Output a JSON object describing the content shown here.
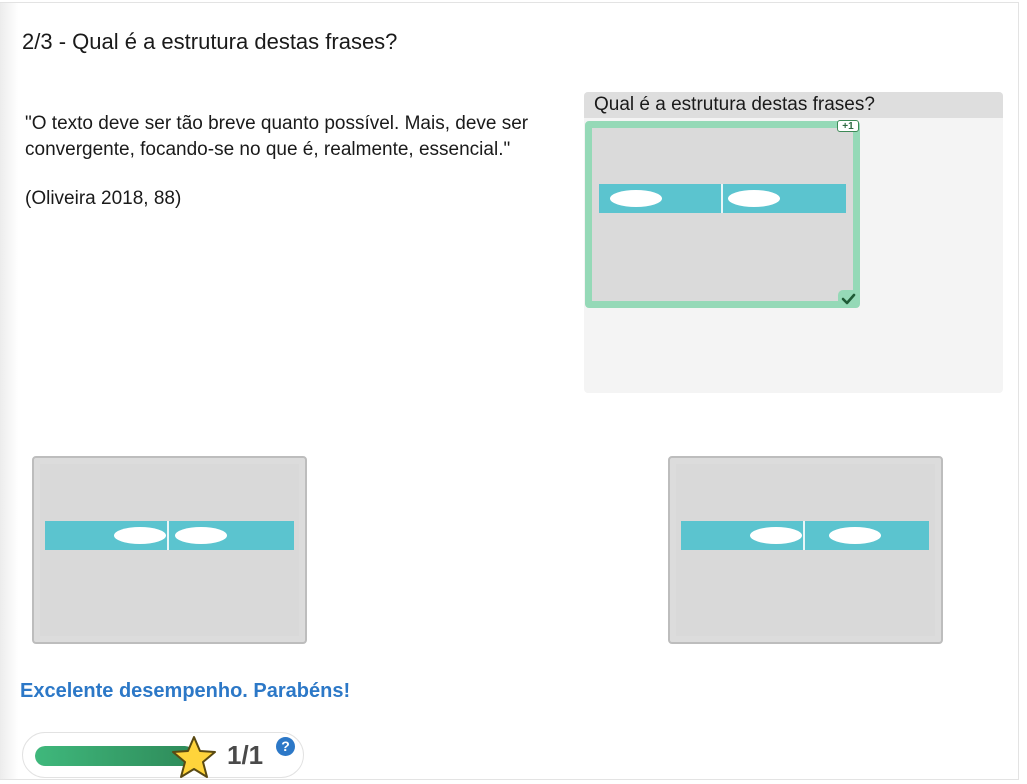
{
  "question": {
    "title": "2/3 - Qual é a estrutura destas frases?",
    "quote": "\"O texto deve ser tão breve quanto possível. Mais, deve ser convergente, focando-se no que é, realmente, essencial.\"",
    "citation": "(Oliveira 2018, 88)"
  },
  "drop_zone": {
    "header": "Qual é a estrutura destas frases?",
    "dropped_card": {
      "score_chip": "+1",
      "status_icon": "check-icon",
      "status": "correct"
    }
  },
  "options": [
    {
      "name": "option-card-1",
      "diagram": "two-segment-bar-pills-right"
    },
    {
      "name": "option-card-2",
      "diagram": "two-segment-bar-pills-right"
    }
  ],
  "feedback": "Excelente desempenho. Parabéns!",
  "score": {
    "progress": 1.0,
    "text": "1/1",
    "star_icon": "star-icon",
    "help_icon": "?"
  },
  "colors": {
    "accent_blue": "#2c78c7",
    "correct_green": "#95d9b7",
    "bar_teal": "#5bc4cf",
    "progress_green": "#3fb87c"
  }
}
